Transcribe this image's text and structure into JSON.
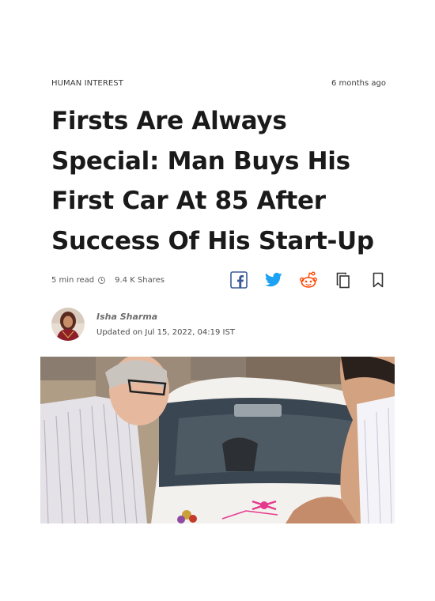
{
  "article": {
    "category": "HUMAN INTEREST",
    "published_ago": "6 months ago",
    "headline": "Firsts Are Always Special: Man Buys His First Car At 85 After Success Of His Start-Up",
    "read_time": "5 min read",
    "shares": "9.4 K Shares"
  },
  "author": {
    "name": "Isha Sharma",
    "updated": "Updated on Jul 15, 2022, 04:19 IST"
  },
  "share_icons": [
    "facebook-icon",
    "twitter-icon",
    "reddit-icon",
    "copy-icon",
    "bookmark-icon"
  ],
  "colors": {
    "facebook": "#3b5998",
    "twitter": "#1da1f2",
    "reddit": "#ff4500",
    "text": "#1a1a1a"
  }
}
